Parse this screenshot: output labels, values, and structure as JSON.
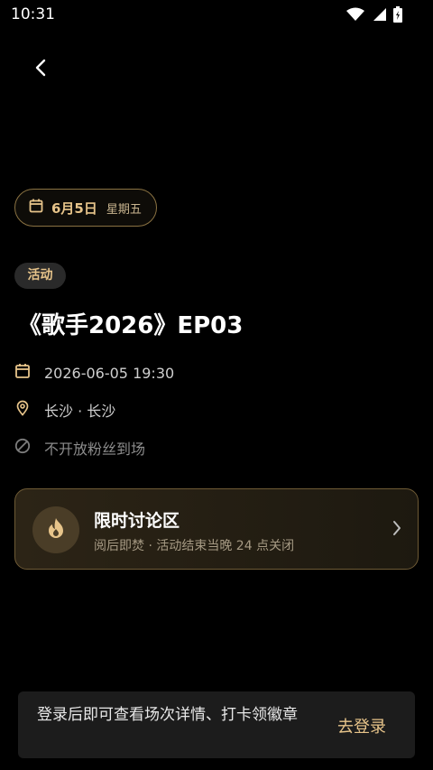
{
  "status_bar": {
    "time": "10:31"
  },
  "event": {
    "date": "6月5日",
    "weekday": "星期五",
    "tag": "活动",
    "title": "《歌手2026》EP03",
    "datetime": "2026-06-05 19:30",
    "location": "长沙 · 长沙",
    "fan_policy": "不开放粉丝到场"
  },
  "discussion": {
    "title": "限时讨论区",
    "subtitle": "阅后即焚 · 活动结束当晚 24 点关闭"
  },
  "login_bar": {
    "message": "登录后即可查看场次详情、打卡领徽章",
    "button_label": "去登录"
  },
  "colors": {
    "accent": "#e7c48a",
    "background": "#000000"
  }
}
